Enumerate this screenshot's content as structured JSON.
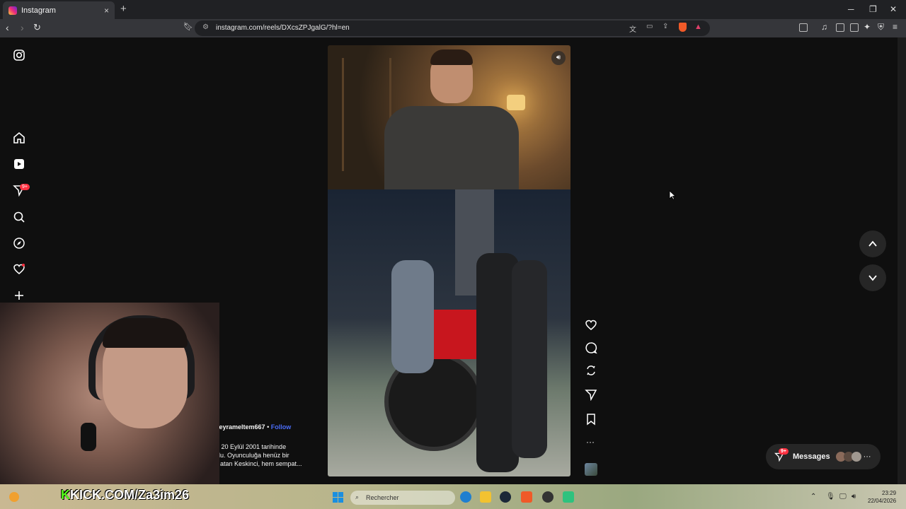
{
  "browser": {
    "tab_title": "Instagram",
    "tab_close": "×",
    "new_tab": "+",
    "url": "instagram.com/reels/DXcsZPJgalG/?hl=en",
    "win_minimize": "─",
    "win_restore": "❐",
    "win_close": "✕"
  },
  "reel": {
    "username": "umeyrameltem667",
    "separator": "•",
    "follow_label": "Follow",
    "caption_lines": [
      "nci. 20 Eylül 2001 tarihinde",
      "oğdu. Oyunculuğa henüz bir",
      "am atan Keskinci, hem sempat..."
    ]
  },
  "sidebar": {
    "notifications_badge": "9+"
  },
  "messages": {
    "label": "Messages",
    "badge": "9+",
    "more": "···"
  },
  "overlay": {
    "stream_tag_prefix": "K",
    "stream_tag": "KICK.COM/Za3im26"
  },
  "taskbar": {
    "search_placeholder": "Rechercher",
    "time": "23:29",
    "date": "22/04/2026"
  },
  "colors": {
    "badge": "#ff3040",
    "follow": "#4a6cf7",
    "kick_green": "#53fc18"
  }
}
